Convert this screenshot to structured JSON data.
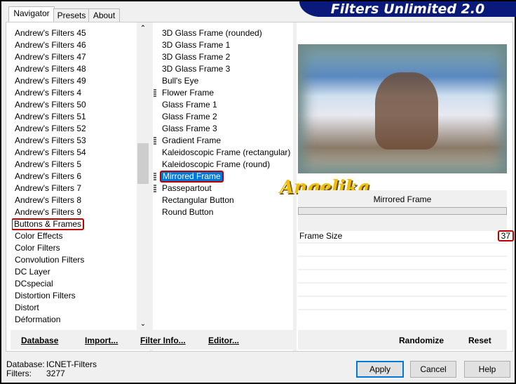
{
  "title": "Filters Unlimited 2.0",
  "tabs": [
    "Navigator",
    "Presets",
    "About"
  ],
  "categories": [
    "Andrew's Filters 45",
    "Andrew's Filters 46",
    "Andrew's Filters 47",
    "Andrew's Filters 48",
    "Andrew's Filters 49",
    "Andrew's Filters 4",
    "Andrew's Filters 50",
    "Andrew's Filters 51",
    "Andrew's Filters 52",
    "Andrew's Filters 53",
    "Andrew's Filters 54",
    "Andrew's Filters 5",
    "Andrew's Filters 6",
    "Andrew's Filters 7",
    "Andrew's Filters 8",
    "Andrew's Filters 9",
    "Buttons & Frames",
    "Color Effects",
    "Color Filters",
    "Convolution Filters",
    "DC Layer",
    "DCspecial",
    "Distortion Filters",
    "Distort",
    "Déformation"
  ],
  "selected_category": "Buttons & Frames",
  "filters": [
    {
      "label": "3D Glass Frame (rounded)"
    },
    {
      "label": "3D Glass Frame 1"
    },
    {
      "label": "3D Glass Frame 2"
    },
    {
      "label": "3D Glass Frame 3"
    },
    {
      "label": "Bull's Eye"
    },
    {
      "label": "Flower Frame",
      "grip": true
    },
    {
      "label": "Glass Frame 1"
    },
    {
      "label": "Glass Frame 2"
    },
    {
      "label": "Glass Frame 3"
    },
    {
      "label": "Gradient Frame",
      "grip": true
    },
    {
      "label": "Kaleidoscopic Frame (rectangular)"
    },
    {
      "label": "Kaleidoscopic Frame (round)"
    },
    {
      "label": "Mirrored Frame",
      "grip": true
    },
    {
      "label": "Passepartout",
      "grip": true
    },
    {
      "label": "Rectangular Button"
    },
    {
      "label": "Round Button"
    }
  ],
  "selected_filter": "Mirrored Frame",
  "preview": {
    "filter_name": "Mirrored Frame",
    "watermark": "Angelika"
  },
  "params": [
    {
      "label": "Frame Size",
      "value": "37"
    }
  ],
  "left_buttons": [
    "Database",
    "Import...",
    "Filter Info...",
    "Editor..."
  ],
  "right_buttons": [
    "Randomize",
    "Reset"
  ],
  "status": {
    "database_label": "Database:",
    "database": "ICNET-Filters",
    "filters_label": "Filters:",
    "filters": "3277"
  },
  "dialog_buttons": [
    "Apply",
    "Cancel",
    "Help"
  ]
}
